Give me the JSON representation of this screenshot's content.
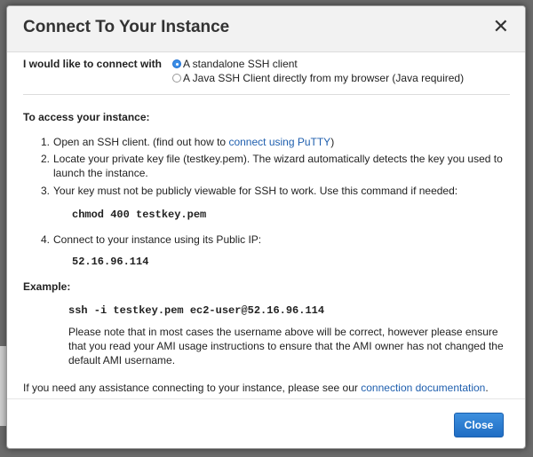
{
  "dialog": {
    "title": "Connect To Your Instance",
    "close_glyph": "✕"
  },
  "connect": {
    "label": "I would like to connect with",
    "options": [
      {
        "label": "A standalone SSH client",
        "selected": true
      },
      {
        "label": "A Java SSH Client directly from my browser (Java required)",
        "selected": false
      }
    ]
  },
  "instructions": {
    "heading": "To access your instance:",
    "step1": {
      "num": "1.",
      "text_before": "Open an SSH client. (find out how to ",
      "link": "connect using PuTTY",
      "text_after": ")"
    },
    "step2": {
      "num": "2.",
      "line1": "Locate your private key file (testkey.pem). The wizard automatically detects the key you used to",
      "line2": "launch the instance."
    },
    "step3": {
      "num": "3.",
      "text": "Your key must not be publicly viewable for SSH to work. Use this command if needed:"
    },
    "chmod_command": "chmod 400 testkey.pem",
    "step4": {
      "num": "4.",
      "text": "Connect to your instance using its Public IP:"
    },
    "public_ip": "52.16.96.114"
  },
  "example": {
    "heading": "Example:",
    "command": "ssh -i testkey.pem ec2-user@52.16.96.114",
    "note": "Please note that in most cases the username above will be correct, however please ensure that you read your AMI usage instructions to ensure that the AMI owner has not changed the default AMI username."
  },
  "help": {
    "text": "If you need any assistance connecting to your instance, please see our ",
    "link": "connection documentation",
    "suffix": "."
  },
  "footer": {
    "close_label": "Close"
  },
  "colors": {
    "primary_button": "#2a7bd4",
    "link": "#1f5fae",
    "radio_selected": "#3b8de6"
  }
}
